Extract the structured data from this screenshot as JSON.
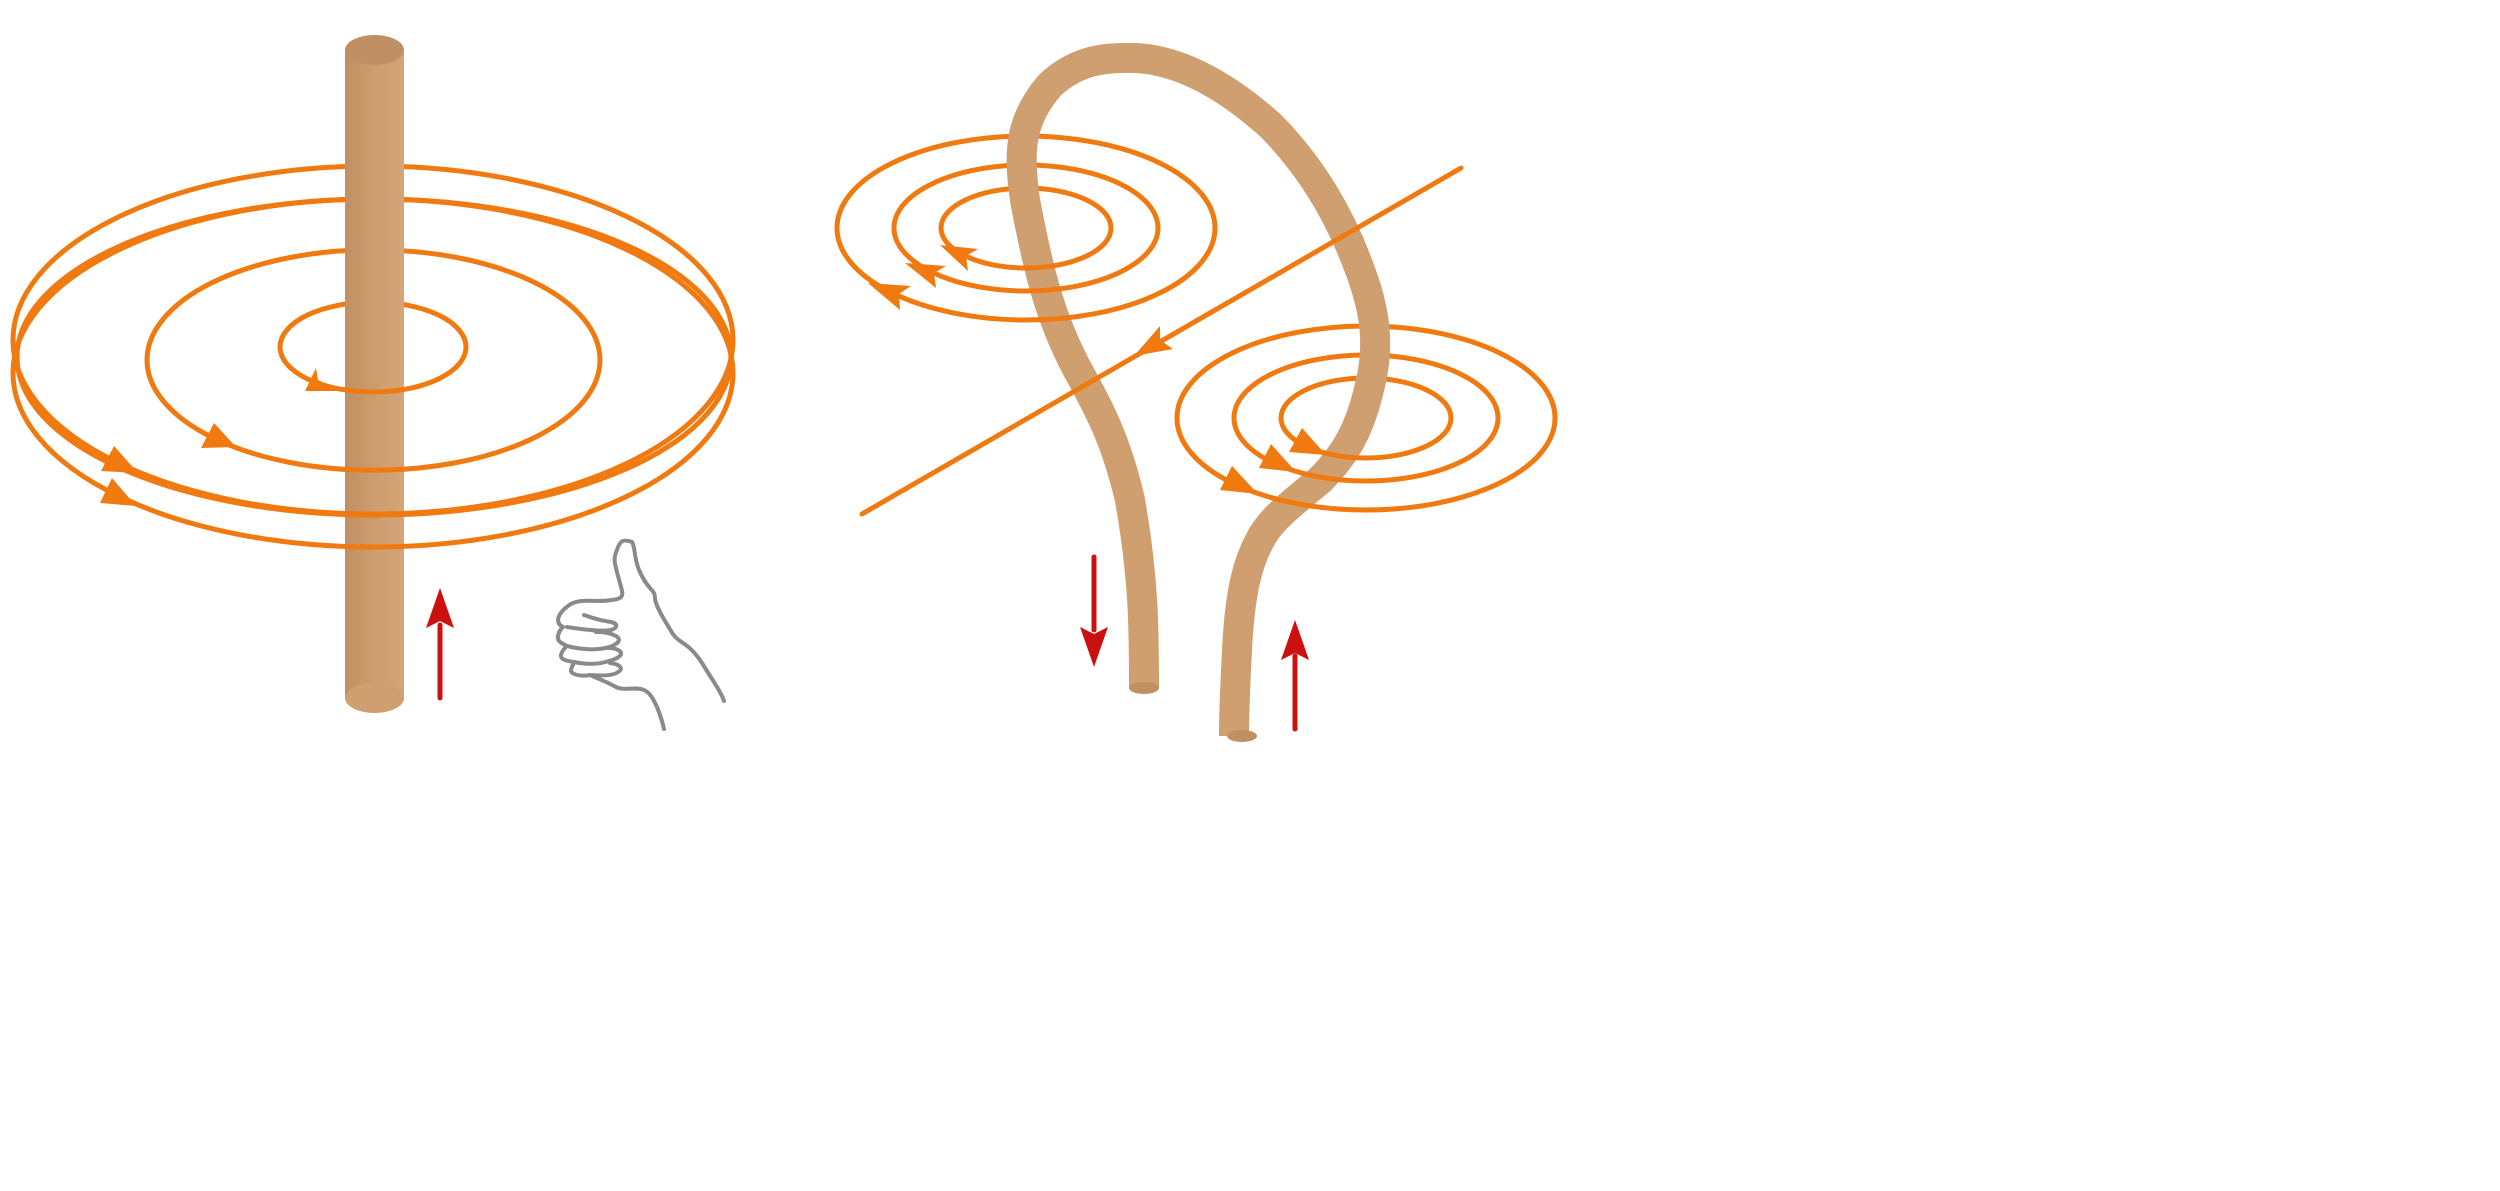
{
  "colors": {
    "field_line": "#f07a10",
    "wire_light": "#d4a578",
    "wire_mid": "#cf9f70",
    "wire_dark": "#c09064",
    "current_arrow": "#cc1010",
    "hand_outline": "#8a8a8a",
    "background": "#ffffff"
  },
  "icons": {
    "hand": "right-hand-thumb-up-icon",
    "current": "arrow-up-icon"
  },
  "panels": [
    {
      "name": "straight-wire",
      "field_loops": 5,
      "current_direction": "up",
      "field_direction": "counterclockwise-from-above"
    },
    {
      "name": "bent-wire",
      "field_loops": 6,
      "current_directions": [
        "down",
        "up"
      ],
      "field_direction": "counterclockwise-from-above"
    }
  ]
}
